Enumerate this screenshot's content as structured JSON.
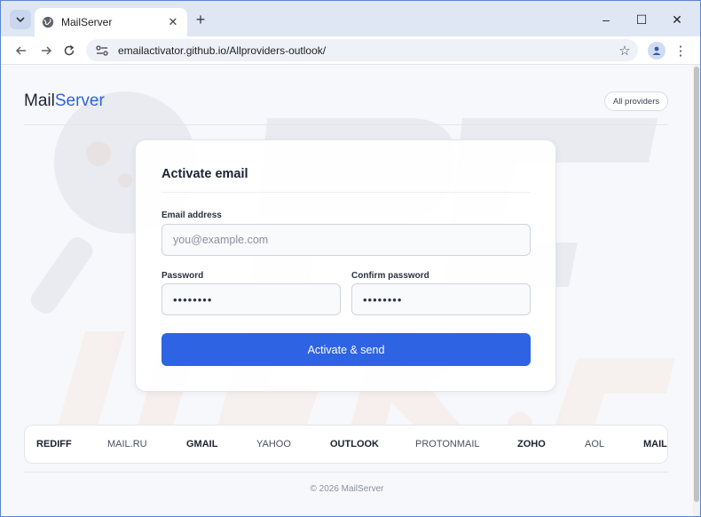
{
  "browser": {
    "tab_title": "MailServer",
    "tab_close": "✕",
    "new_tab": "+",
    "url": "emailactivator.github.io/Allproviders-outlook/",
    "window_controls": [
      "–",
      "☐",
      "✕"
    ]
  },
  "header": {
    "brand_part1": "Mail",
    "brand_part2": "Server",
    "providers_button": "All providers"
  },
  "form": {
    "title": "Activate email",
    "email_label": "Email address",
    "email_placeholder": "you@example.com",
    "password_label": "Password",
    "password_value": "••••••••",
    "confirm_label": "Confirm password",
    "confirm_value": "••••••••",
    "submit_label": "Activate & send"
  },
  "providers": [
    {
      "name": "REDIFF"
    },
    {
      "name": "MAIL.RU"
    },
    {
      "name": "GMAIL"
    },
    {
      "name": "YAHOO"
    },
    {
      "name": "OUTLOOK"
    },
    {
      "name": "PROTONMAIL"
    },
    {
      "name": "ZOHO"
    },
    {
      "name": "AOL"
    },
    {
      "name": "MAIL"
    }
  ],
  "footer": {
    "text": "© 2026 MailServer"
  },
  "colors": {
    "accent": "#2e63e4",
    "brand_blue": "#2e63d6",
    "chrome_frame": "#dfe7f5"
  },
  "icons": [
    "globe-icon",
    "tab-search-icon",
    "back-arrow-icon",
    "forward-arrow-icon",
    "reload-icon",
    "site-info-icon",
    "bookmark-star-icon",
    "profile-icon",
    "more-menu-icon"
  ]
}
